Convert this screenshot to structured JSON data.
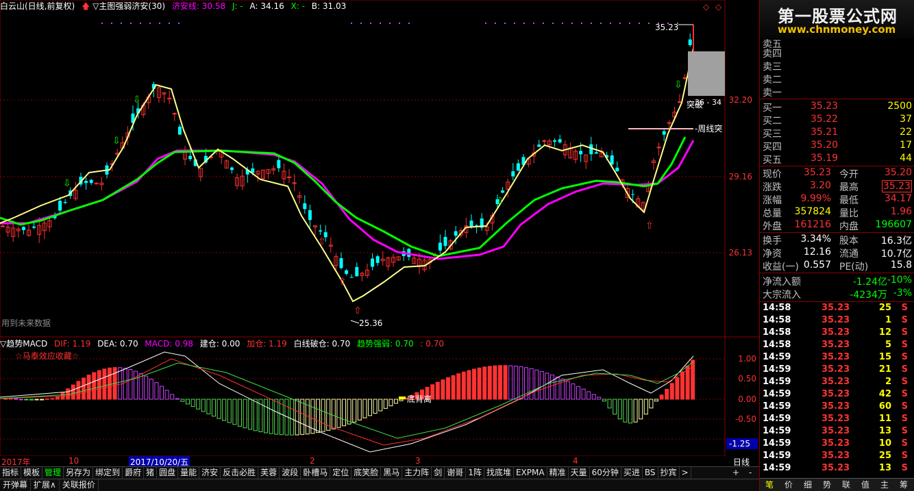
{
  "header": {
    "stock": "白云山(日线,前复权)",
    "indicator": "▽主图强弱济安(30)",
    "jian_label": "济安线: 30.58",
    "j_label": "J: -",
    "a_label": "A: 34.16",
    "x_label": "X: -",
    "b_label": "B: 31.03"
  },
  "indicator_bar": {
    "name": "▽趋势MACD",
    "dif": "DIF: 1.19",
    "dea": "DEA: 0.70",
    "macd": "MACD: 0.98",
    "jiancang": "建仓: 0.00",
    "jiacang": "加仓: 1.19",
    "baixian": "白线破仓: 0.70",
    "qushi": "趋势强弱: 0.70",
    "tail": ": 0.70",
    "subtitle": "☆马泰效应收藏☆"
  },
  "annotations": {
    "future_data": "用到未来数据",
    "high_label": "35.23",
    "low_label": "25.36",
    "breakout": "突破",
    "breakout_val": "36 - 34",
    "weekly": "-周线突",
    "bottom_divergence": "底背离"
  },
  "price_axis": [
    "32.20",
    "29.16",
    "26.13"
  ],
  "macd_axis": [
    "1.00",
    "0.50",
    "0.00",
    "-0.50",
    "-1.00"
  ],
  "macd_axis_current": "-1.25",
  "x_axis": {
    "year": "2017年",
    "m10": "10",
    "cursor_date": "2017/10/20/五",
    "m2": "2",
    "m3": "3",
    "m4": "4",
    "period": "日线"
  },
  "logo": {
    "title": "第一股票公式网",
    "url": "www.chnmoney.com"
  },
  "order_book": {
    "asks": [
      {
        "label": "卖五",
        "price": "",
        "vol": ""
      },
      {
        "label": "卖四",
        "price": "",
        "vol": ""
      },
      {
        "label": "卖三",
        "price": "",
        "vol": ""
      },
      {
        "label": "卖二",
        "price": "",
        "vol": ""
      },
      {
        "label": "卖一",
        "price": "",
        "vol": ""
      }
    ],
    "bids": [
      {
        "label": "买一",
        "price": "35.23",
        "vol": "2500"
      },
      {
        "label": "买二",
        "price": "35.22",
        "vol": "37"
      },
      {
        "label": "买三",
        "price": "35.21",
        "vol": "22"
      },
      {
        "label": "买四",
        "price": "35.20",
        "vol": "17"
      },
      {
        "label": "买五",
        "price": "35.19",
        "vol": "44"
      }
    ]
  },
  "stats": [
    {
      "l1": "现价",
      "v1": "35.23",
      "l2": "今开",
      "v2": "35.20"
    },
    {
      "l1": "涨跌",
      "v1": "3.20",
      "l2": "最高",
      "v2": "35.23"
    },
    {
      "l1": "涨幅",
      "v1": "9.99%",
      "l2": "最低",
      "v2": "34.17"
    },
    {
      "l1": "总量",
      "v1": "357824",
      "l2": "量比",
      "v2": "1.96"
    },
    {
      "l1": "外盘",
      "v1": "161216",
      "l2": "内盘",
      "v2": "196607"
    }
  ],
  "stats2": [
    {
      "l1": "换手",
      "v1": "3.34%",
      "l2": "股本",
      "v2": "16.3亿"
    },
    {
      "l1": "净资",
      "v1": "12.16",
      "l2": "流通",
      "v2": "10.7亿"
    },
    {
      "l1": "收益(一)",
      "v1": "0.557",
      "l2": "PE(动)",
      "v2": "15.8"
    }
  ],
  "flows": [
    {
      "label": "净流入额",
      "v1": "-1.24亿",
      "v2": "-10%"
    },
    {
      "label": "大宗流入",
      "v1": "-4234万",
      "v2": "-3%"
    }
  ],
  "ticks": [
    {
      "time": "14:58",
      "price": "35.23",
      "vol": "25",
      "dir": "S"
    },
    {
      "time": "14:58",
      "price": "35.23",
      "vol": "1",
      "dir": "S"
    },
    {
      "time": "14:58",
      "price": "35.23",
      "vol": "12",
      "dir": "S"
    },
    {
      "time": "14:58",
      "price": "35.23",
      "vol": "5",
      "dir": "S"
    },
    {
      "time": "14:59",
      "price": "35.23",
      "vol": "15",
      "dir": "S"
    },
    {
      "time": "14:59",
      "price": "35.23",
      "vol": "21",
      "dir": "S"
    },
    {
      "time": "14:59",
      "price": "35.23",
      "vol": "2",
      "dir": "S"
    },
    {
      "time": "14:59",
      "price": "35.23",
      "vol": "42",
      "dir": "S"
    },
    {
      "time": "14:59",
      "price": "35.23",
      "vol": "60",
      "dir": "S"
    },
    {
      "time": "14:59",
      "price": "35.23",
      "vol": "11",
      "dir": "S"
    },
    {
      "time": "14:59",
      "price": "35.23",
      "vol": "13",
      "dir": "S"
    },
    {
      "time": "14:59",
      "price": "35.23",
      "vol": "10",
      "dir": "S"
    },
    {
      "time": "14:59",
      "price": "35.23",
      "vol": "25",
      "dir": "S"
    },
    {
      "time": "14:59",
      "price": "35.23",
      "vol": "13",
      "dir": "S"
    }
  ],
  "right_tabs": [
    "笔",
    "价",
    "细",
    "势",
    "联",
    "值",
    "主",
    "筹"
  ],
  "toolbar": [
    "指标",
    "模板",
    "管理",
    "另存为",
    "绑定到",
    "爵府",
    "猪",
    "圆盘",
    "量能",
    "济安",
    "反击必胜",
    "芙蓉",
    "波段",
    "卧槽马",
    "定位",
    "底笑脸",
    "黑马",
    "主力阵",
    "剑",
    "谢哥",
    "1阵",
    "找底堆",
    "EXPMA",
    "精准",
    "天量",
    "60分钟",
    "买进",
    "BS",
    "抄宾",
    ">"
  ],
  "toolbar_right": [
    "+",
    "-"
  ],
  "statusbar": [
    "开弹幕",
    "扩展∧",
    "关联报价"
  ],
  "colors": {
    "up": "#ff3232",
    "down": "#00ffff",
    "green": "#00ff00",
    "yellow": "#ffff00",
    "magenta": "#ff00ff",
    "white": "#ffffff",
    "axis": "#ff3232",
    "purple": "#cc44ff"
  }
}
